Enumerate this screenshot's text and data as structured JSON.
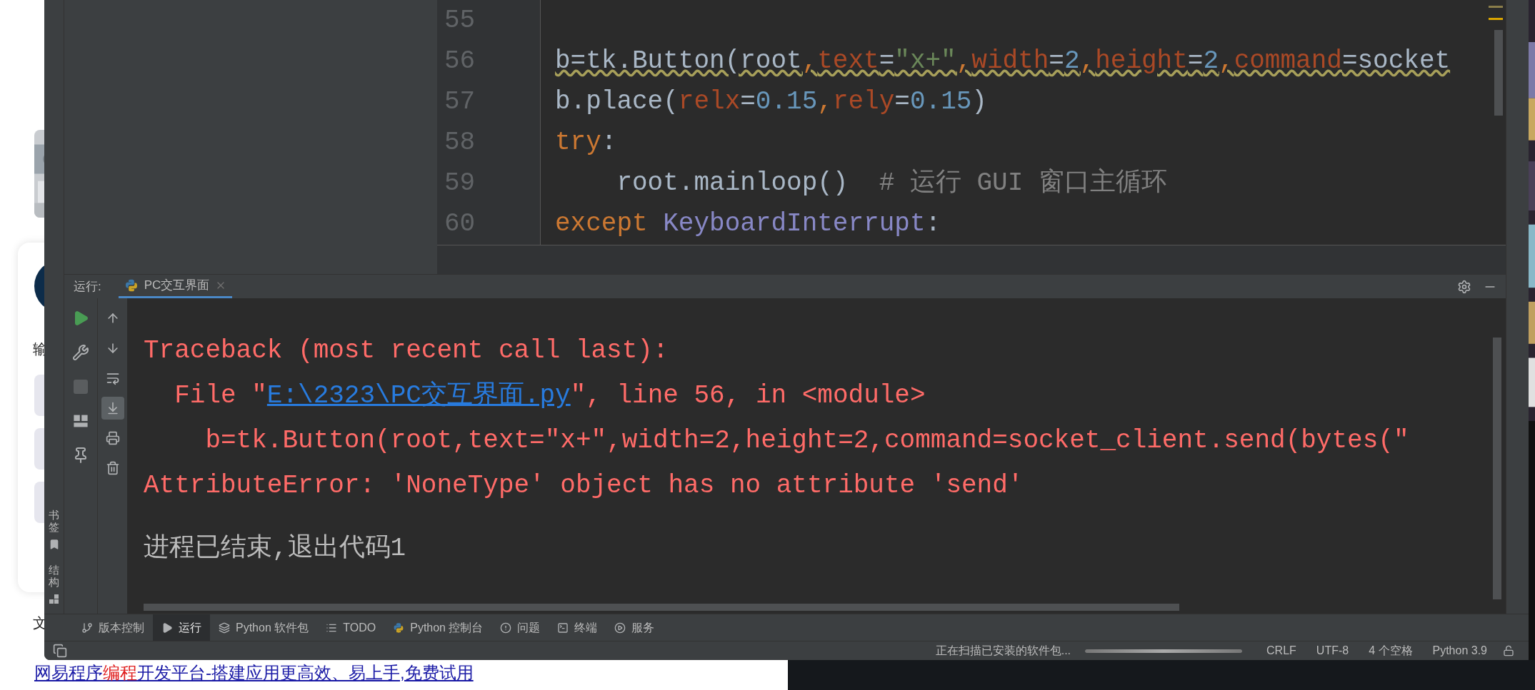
{
  "browser_page": {
    "fragments": [
      {
        "text": "输"
      },
      {
        "text": "文"
      }
    ],
    "link": {
      "before": "网易程序",
      "highlight": "编程",
      "after": "开发平台-搭建应用更高效、易上手,免费试用"
    }
  },
  "editor": {
    "lines": [
      {
        "number": "55"
      },
      {
        "number": "56",
        "warning": true,
        "tokens": [
          {
            "kind": "plain",
            "text": "b=tk.Button(root"
          },
          {
            "kind": "keyword",
            "text": ","
          },
          {
            "kind": "param",
            "text": "text"
          },
          {
            "kind": "plain",
            "text": "="
          },
          {
            "kind": "string",
            "text": "\"x+\""
          },
          {
            "kind": "keyword",
            "text": ","
          },
          {
            "kind": "param",
            "text": "width"
          },
          {
            "kind": "plain",
            "text": "="
          },
          {
            "kind": "number",
            "text": "2"
          },
          {
            "kind": "keyword",
            "text": ","
          },
          {
            "kind": "param",
            "text": "height"
          },
          {
            "kind": "plain",
            "text": "="
          },
          {
            "kind": "number",
            "text": "2"
          },
          {
            "kind": "keyword",
            "text": ","
          },
          {
            "kind": "param",
            "text": "command"
          },
          {
            "kind": "plain",
            "text": "=socket"
          }
        ]
      },
      {
        "number": "57",
        "warning": false,
        "tokens": [
          {
            "kind": "plain",
            "text": "b.place("
          },
          {
            "kind": "param",
            "text": "relx"
          },
          {
            "kind": "plain",
            "text": "="
          },
          {
            "kind": "number",
            "text": "0.15"
          },
          {
            "kind": "keyword",
            "text": ","
          },
          {
            "kind": "param",
            "text": "rely"
          },
          {
            "kind": "plain",
            "text": "="
          },
          {
            "kind": "number",
            "text": "0.15"
          },
          {
            "kind": "plain",
            "text": ")"
          }
        ]
      },
      {
        "number": "58",
        "warning": false,
        "tokens": [
          {
            "kind": "keyword",
            "text": "try"
          },
          {
            "kind": "plain",
            "text": ":"
          }
        ]
      },
      {
        "number": "59",
        "warning": false,
        "tokens": [
          {
            "kind": "plain",
            "text": "    root.mainloop()  "
          },
          {
            "kind": "comment",
            "text": "# 运行 GUI 窗口主循环"
          }
        ]
      },
      {
        "number": "60",
        "warning": false,
        "tokens": [
          {
            "kind": "keyword",
            "text": "except "
          },
          {
            "kind": "class",
            "text": "KeyboardInterrupt"
          },
          {
            "kind": "plain",
            "text": ":"
          }
        ]
      }
    ]
  },
  "run": {
    "label": "运行:",
    "tab": {
      "title": "PC交互界面",
      "selected": true
    },
    "toolbar_left": [
      {
        "disabled": false
      },
      {
        "disabled": false
      },
      {
        "disabled": true
      },
      {
        "disabled": false
      },
      {
        "disabled": false
      }
    ],
    "toolbar_right": [
      {
        "selected": false
      },
      {
        "selected": false
      },
      {
        "selected": false
      },
      {
        "selected": true
      },
      {
        "selected": false
      },
      {
        "selected": false
      }
    ],
    "console": [
      {
        "kind": "error",
        "text": "Traceback (most recent call last):"
      },
      {
        "kind": "error",
        "text": "  File \"",
        "link": "E:\\2323\\PC交互界面.py",
        "after": "\", line 56, in <module>"
      },
      {
        "kind": "error",
        "text": "    b=tk.Button(root,text=\"x+\",width=2,height=2,command=socket_client.send(bytes(\""
      },
      {
        "kind": "error",
        "text": "AttributeError: 'NoneType' object has no attribute 'send'"
      },
      {
        "kind": "info",
        "text": "进程已结束,退出代码1"
      }
    ]
  },
  "side_labels": [
    {
      "label": "书签"
    },
    {
      "label": "结构"
    }
  ],
  "tool_windows": [
    {
      "label": "版本控制",
      "selected": false
    },
    {
      "label": "运行",
      "selected": true
    },
    {
      "label": "Python 软件包",
      "selected": false
    },
    {
      "label": "TODO",
      "selected": false
    },
    {
      "label": "Python 控制台",
      "selected": false
    },
    {
      "label": "问题",
      "selected": false
    },
    {
      "label": "终端",
      "selected": false
    },
    {
      "label": "服务",
      "selected": false
    }
  ],
  "status_bar": {
    "message": "正在扫描已安装的软件包...",
    "progress": {
      "level": 1
    },
    "items": [
      "CRLF",
      "UTF-8",
      "4 个空格",
      "Python 3.9"
    ]
  }
}
